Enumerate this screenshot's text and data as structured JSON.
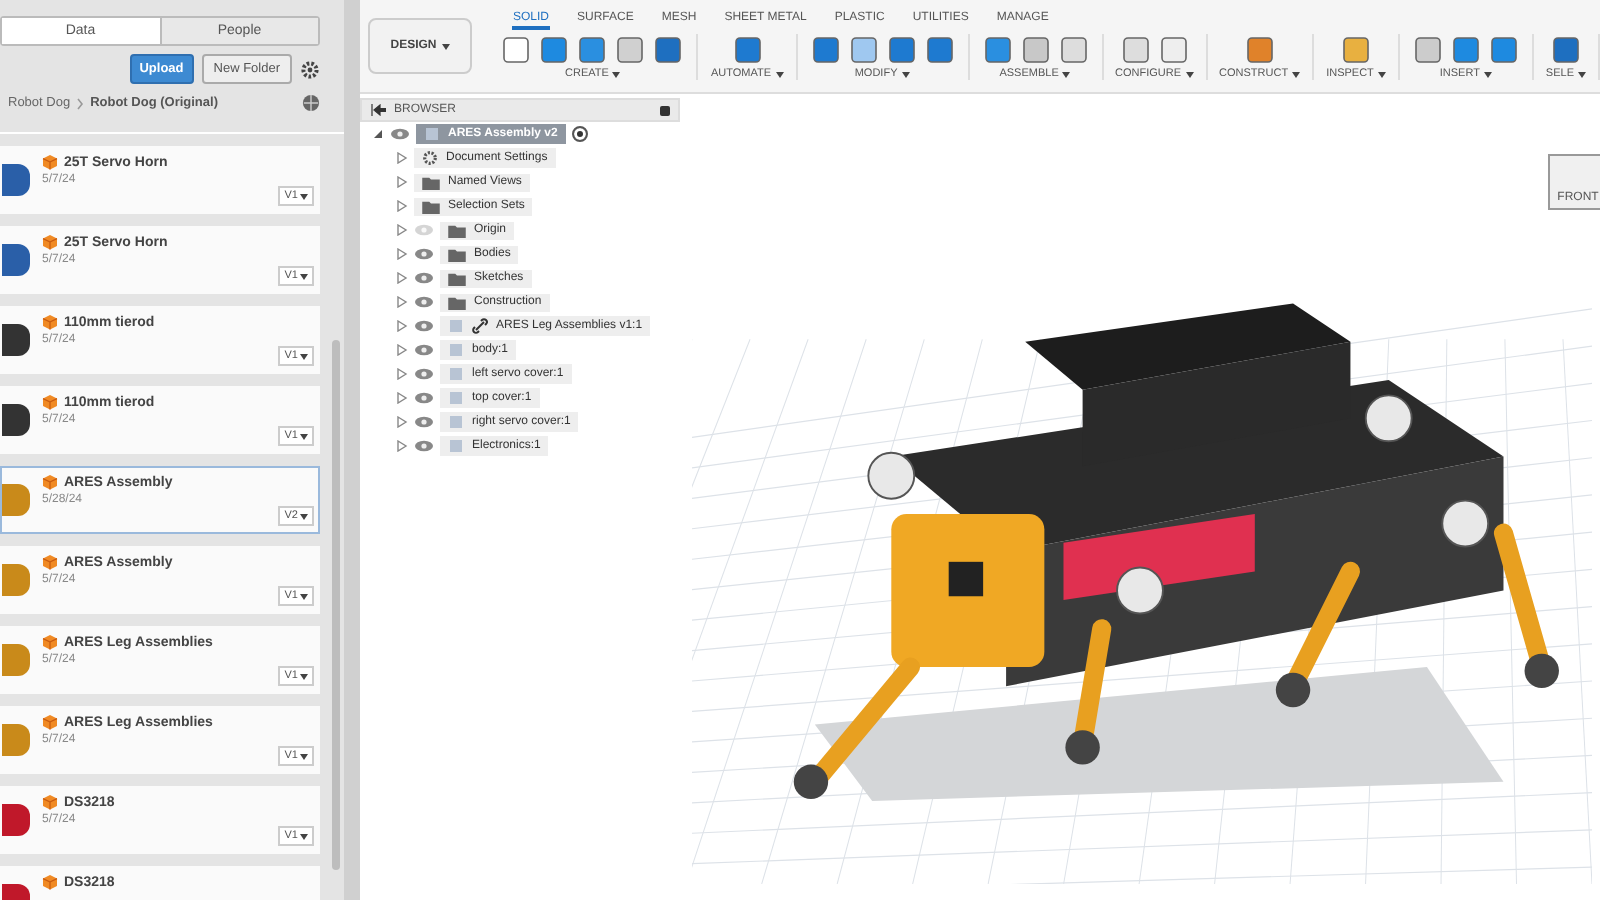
{
  "data_panel": {
    "tabs": [
      {
        "label": "Data",
        "selected": true
      },
      {
        "label": "People",
        "selected": false
      }
    ],
    "upload_button": "Upload",
    "new_folder_button": "New Folder",
    "breadcrumb": [
      "Robot Dog",
      "Robot Dog (Original)"
    ],
    "files": [
      {
        "name": "25T Servo Horn",
        "date": "5/7/24",
        "version": "V1",
        "selected": false,
        "kind": "horn"
      },
      {
        "name": "25T Servo Horn",
        "date": "5/7/24",
        "version": "V1",
        "selected": false,
        "kind": "horn"
      },
      {
        "name": "110mm tierod",
        "date": "5/7/24",
        "version": "V1",
        "selected": false,
        "kind": "rod"
      },
      {
        "name": "110mm tierod",
        "date": "5/7/24",
        "version": "V1",
        "selected": false,
        "kind": "rod"
      },
      {
        "name": "ARES Assembly",
        "date": "5/28/24",
        "version": "V2",
        "selected": true,
        "kind": "robot"
      },
      {
        "name": "ARES Assembly",
        "date": "5/7/24",
        "version": "V1",
        "selected": false,
        "kind": "robot"
      },
      {
        "name": "ARES Leg Assemblies",
        "date": "5/7/24",
        "version": "V1",
        "selected": false,
        "kind": "robot"
      },
      {
        "name": "ARES Leg Assemblies",
        "date": "5/7/24",
        "version": "V1",
        "selected": false,
        "kind": "robot"
      },
      {
        "name": "DS3218",
        "date": "5/7/24",
        "version": "V1",
        "selected": false,
        "kind": "servo"
      },
      {
        "name": "DS3218",
        "kind": "servo",
        "selected": false
      }
    ]
  },
  "toolbar": {
    "workspace_button": "DESIGN",
    "tabs": [
      {
        "label": "SOLID",
        "selected": true
      },
      {
        "label": "SURFACE",
        "selected": false
      },
      {
        "label": "MESH",
        "selected": false
      },
      {
        "label": "SHEET METAL",
        "selected": false
      },
      {
        "label": "PLASTIC",
        "selected": false
      },
      {
        "label": "UTILITIES",
        "selected": false
      },
      {
        "label": "MANAGE",
        "selected": false
      }
    ],
    "groups": [
      "CREATE",
      "AUTOMATE",
      "MODIFY",
      "ASSEMBLE",
      "CONFIGURE",
      "CONSTRUCT",
      "INSPECT",
      "INSERT",
      "SELE"
    ]
  },
  "browser": {
    "title": "BROWSER",
    "root": {
      "label": "ARES Assembly v2",
      "expanded": true,
      "selected": true,
      "children": [
        {
          "label": "Document Settings",
          "kind": "settings"
        },
        {
          "label": "Named Views",
          "kind": "folder"
        },
        {
          "label": "Selection Sets",
          "kind": "folder"
        },
        {
          "label": "Origin",
          "kind": "folder",
          "visible": false
        },
        {
          "label": "Bodies",
          "kind": "folder",
          "visible": true
        },
        {
          "label": "Sketches",
          "kind": "folder",
          "visible": true
        },
        {
          "label": "Construction",
          "kind": "folder",
          "visible": true
        },
        {
          "label": "ARES Leg Assemblies v1:1",
          "kind": "link",
          "visible": true
        },
        {
          "label": "body:1",
          "kind": "component",
          "visible": true
        },
        {
          "label": "left servo cover:1",
          "kind": "component",
          "visible": true
        },
        {
          "label": "top cover:1",
          "kind": "component",
          "visible": true
        },
        {
          "label": "right servo cover:1",
          "kind": "component",
          "visible": true
        },
        {
          "label": "Electronics:1",
          "kind": "component",
          "visible": true
        }
      ]
    }
  },
  "view_cube": {
    "label": "FRONT"
  }
}
